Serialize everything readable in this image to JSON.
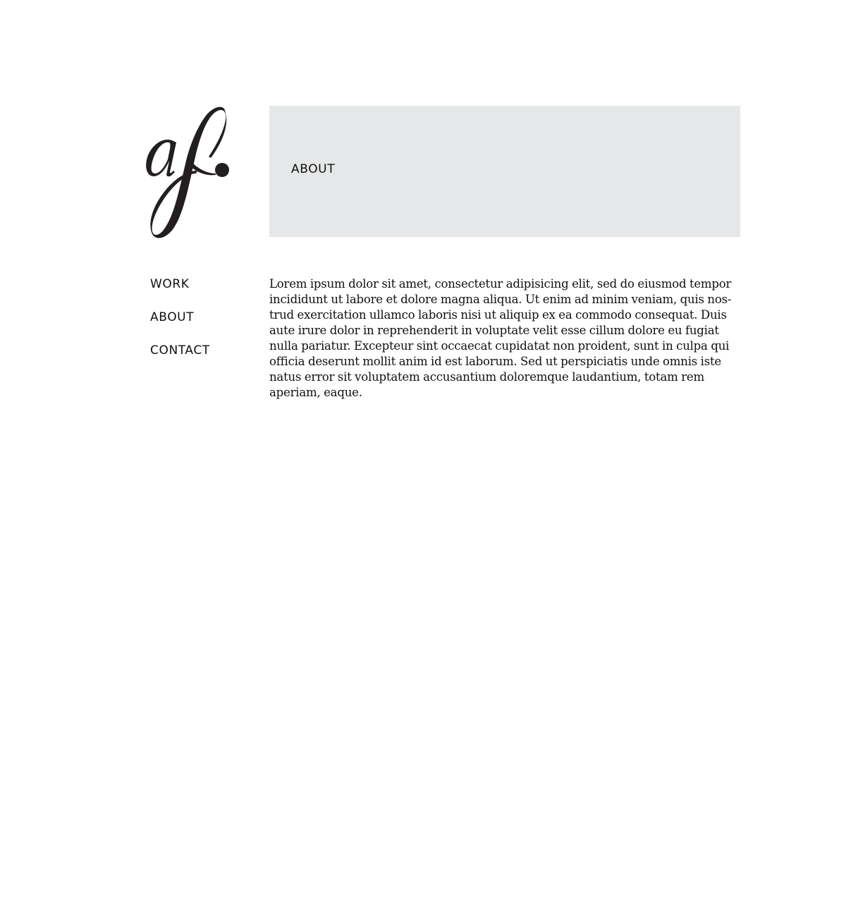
{
  "logo": {
    "text": "af.",
    "color": "#231f20"
  },
  "hero": {
    "title": "ABOUT",
    "background": "#e6e7e8"
  },
  "nav": {
    "items": [
      {
        "label": "WORK"
      },
      {
        "label": "ABOUT"
      },
      {
        "label": "CONTACT"
      }
    ]
  },
  "content": {
    "paragraph": "Lorem ipsum dolor sit amet, consectetur adipisicing elit, sed do eiusmod tempor incididunt ut labore et dolore magna aliqua. Ut enim ad minim veniam, quis nos­trud exercitation ullamco laboris nisi ut aliquip ex ea commodo consequat. Duis aute irure dolor in reprehenderit in voluptate velit esse cillum dolore eu fugiat nulla pariatur. Excepteur sint occaecat cupidatat non proident, sunt in culpa qui officia deserunt mollit anim id est laborum. Sed ut perspiciatis unde omnis iste natus error sit voluptatem accusantium doloremque laudantium, totam rem aperiam, eaque."
  }
}
